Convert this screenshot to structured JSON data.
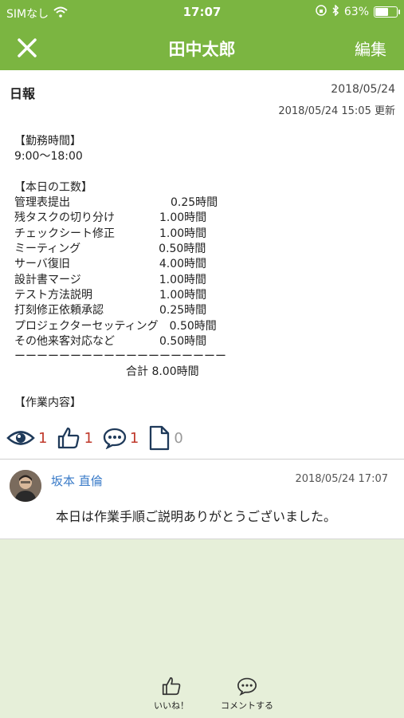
{
  "status_bar": {
    "carrier": "SIMなし",
    "time": "17:07",
    "battery": "63%",
    "battery_level": 0.63
  },
  "nav": {
    "title": "田中太郎",
    "edit_label": "編集"
  },
  "report": {
    "title": "日報",
    "date": "2018/05/24",
    "updated": "2018/05/24 15:05 更新",
    "body_lines": [
      "【勤務時間】",
      "9:00〜18:00",
      "",
      "【本日の工数】",
      "管理表提出　　　　　　　　　0.25時間",
      "残タスクの切り分け　　　　1.00時間",
      "チェックシート修正　　　　1.00時間",
      "ミーティング　　　　　　　0.50時間",
      "サーバ復旧　　　　　　　　4.00時間",
      "設計書マージ　　　　　　　1.00時間",
      "テスト方法説明　　　　　　1.00時間",
      "打刻修正依頼承認　　　　　0.25時間",
      "プロジェクターセッティング　0.50時間",
      "その他来客対応など　　　　0.50時間",
      "ーーーーーーーーーーーーーーーーーーー",
      "　　　　　　　　　　合計 8.00時間",
      "",
      "【作業内容】"
    ],
    "stats": {
      "views": "1",
      "likes": "1",
      "comments": "1",
      "attachments": "0"
    }
  },
  "comment": {
    "author": "坂本 直倫",
    "time": "2018/05/24 17:07",
    "text": "本日は作業手順ご説明ありがとうございました。"
  },
  "actions": {
    "like_label": "いいね！",
    "comment_label": "コメントする"
  },
  "colors": {
    "header": "#7bb541",
    "background": "#e6efd9",
    "count": "#c0392b",
    "author": "#3a7bc8",
    "icon": "#1f3a5a"
  }
}
